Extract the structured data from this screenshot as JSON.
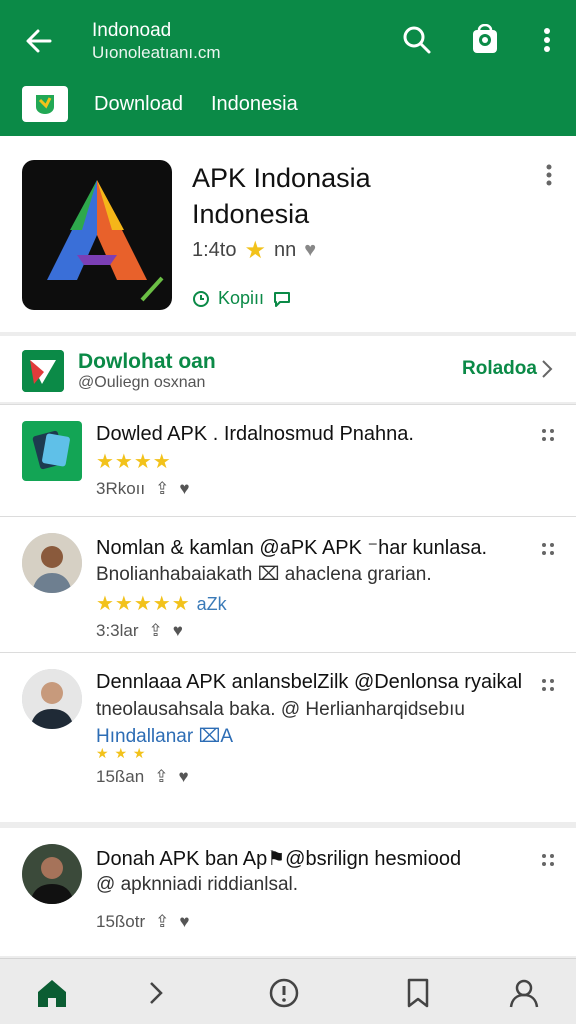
{
  "appbar": {
    "title": "Indonoad",
    "subtitle": "Uıonoleatıanı.cm",
    "back_icon": "arrow-left-icon",
    "search_icon": "search-icon",
    "shop_icon": "shopping-bag-icon",
    "more_icon": "more-vert-icon",
    "sub_items": [
      "Download",
      "Indonesia"
    ]
  },
  "app": {
    "name_line1": "APK Indonasia",
    "name_line2": "Indonesia",
    "rating_text": "1:4to",
    "rating_suffix": "nn",
    "link_text": "Kopiıı",
    "brand_colors": {
      "primary": "#0b8a47",
      "star": "#f2c21b"
    }
  },
  "developer": {
    "name": "Dowlohat oan",
    "handle": "@Ouliegn osxnan",
    "link": "Roladoa"
  },
  "items": [
    {
      "title": "Dowled APK . Irdalnosmud Pnahna.",
      "desc": "",
      "stars": "★★★★",
      "tag": "",
      "foot": "3Rkoıı"
    },
    {
      "title": "Nomlan & kamlan @aPK APK ⁻har kunlasa.",
      "desc": "Bnolianhabaiakath ⌧ ahaclena grarian.",
      "stars": "★★★★★",
      "tag": "aZk",
      "foot": "3:3lar"
    },
    {
      "title": "Dennlaaa APK anlansbelZilk @Denlonsa ryaikal",
      "desc": "Hındallanar ⌧A",
      "desc_top": "tneolausahsala baka. @ Herlianharqidsebıu",
      "stars": "★ ★ ★",
      "tag": "",
      "foot": "15ßan"
    },
    {
      "title": "Donah APK ban Ap⚑@bsrilign hesmiood",
      "desc": "@ apknniadi riddianlsal.",
      "stars": "",
      "tag": "",
      "foot": "15ßotr"
    }
  ],
  "bottomnav": {
    "items": [
      "home-icon",
      "chevron-right-icon",
      "info-icon",
      "bookmark-icon",
      "person-icon"
    ]
  }
}
